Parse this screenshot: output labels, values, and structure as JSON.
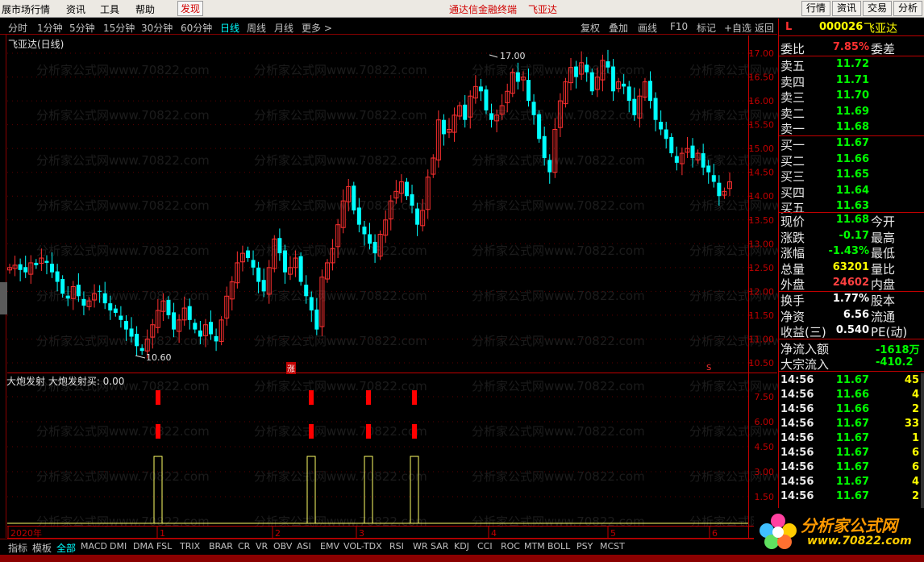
{
  "menubar": {
    "items": [
      "展市场行情",
      "资讯",
      "工具",
      "帮助",
      "发现"
    ],
    "center_text": "通达信金融终端",
    "center_stock": "飞亚达",
    "right_buttons": [
      "行情",
      "资讯",
      "交易",
      "分析"
    ]
  },
  "periods": {
    "items": [
      "分时",
      "1分钟",
      "5分钟",
      "15分钟",
      "30分钟",
      "60分钟",
      "日线",
      "周线",
      "月线",
      "更多 >"
    ],
    "active": "日线",
    "tools": [
      "复权",
      "叠加",
      "画线",
      "F10",
      "标记",
      "+自选",
      "返回"
    ]
  },
  "chart": {
    "title": "飞亚达(日线)",
    "high_label": "17.00",
    "low_label": "10.60",
    "marker_up": "涨",
    "marker_s": "S",
    "price_axis": [
      "17.00",
      "16.50",
      "16.00",
      "15.50",
      "15.00",
      "14.50",
      "14.00",
      "13.50",
      "13.00",
      "12.50",
      "12.00",
      "11.50",
      "11.00",
      "10.50"
    ],
    "indicator_title": "大炮发射  大炮发射买: 0.00",
    "indicator_axis": [
      "7.50",
      "6.00",
      "4.50",
      "3.00",
      "1.50"
    ],
    "date_axis": [
      "2020年",
      "1",
      "2",
      "3",
      "4",
      "5",
      "6"
    ]
  },
  "chart_data": {
    "type": "table",
    "title": "飞亚达(日线)",
    "series": [
      {
        "name": "大炮发射买",
        "values": [
          0.0
        ]
      }
    ],
    "price_range": [
      10.5,
      17.0
    ],
    "high": 17.0,
    "low": 10.6
  },
  "quote": {
    "code": "000026",
    "name": "飞亚达",
    "wb_label": "委比",
    "wb_value": "7.85%",
    "wc_label": "委差",
    "sell": [
      {
        "label": "卖五",
        "price": "11.72"
      },
      {
        "label": "卖四",
        "price": "11.71"
      },
      {
        "label": "卖三",
        "price": "11.70"
      },
      {
        "label": "卖二",
        "price": "11.69"
      },
      {
        "label": "卖一",
        "price": "11.68"
      }
    ],
    "buy": [
      {
        "label": "买一",
        "price": "11.67"
      },
      {
        "label": "买二",
        "price": "11.66"
      },
      {
        "label": "买三",
        "price": "11.65"
      },
      {
        "label": "买四",
        "price": "11.64"
      },
      {
        "label": "买五",
        "price": "11.63"
      }
    ],
    "stats": [
      {
        "label": "现价",
        "value": "11.68",
        "label2": "今开",
        "color": "#00ff00"
      },
      {
        "label": "涨跌",
        "value": "-0.17",
        "label2": "最高",
        "color": "#00ff00"
      },
      {
        "label": "涨幅",
        "value": "-1.43%",
        "label2": "最低",
        "color": "#00ff00"
      },
      {
        "label": "总量",
        "value": "63201",
        "label2": "量比",
        "color": "#ffff00"
      },
      {
        "label": "外盘",
        "value": "24602",
        "label2": "内盘",
        "color": "#ff4040"
      }
    ],
    "stats2": [
      {
        "label": "换手",
        "value": "1.77%",
        "label2": "股本",
        "color": "#ffffff"
      },
      {
        "label": "净资",
        "value": "6.56",
        "label2": "流通",
        "color": "#ffffff"
      },
      {
        "label": "收益(三)",
        "value": "0.540",
        "label2": "PE(动)",
        "color": "#ffffff"
      }
    ],
    "flow": [
      {
        "label": "净流入额",
        "value": "-1618万",
        "color": "#00ff00"
      },
      {
        "label": "大宗流入",
        "value": "-410.2",
        "color": "#00ff00"
      }
    ],
    "ticks": [
      {
        "time": "14:56",
        "price": "11.67",
        "vol": "45"
      },
      {
        "time": "14:56",
        "price": "11.66",
        "vol": "4"
      },
      {
        "time": "14:56",
        "price": "11.66",
        "vol": "2"
      },
      {
        "time": "14:56",
        "price": "11.67",
        "vol": "33"
      },
      {
        "time": "14:56",
        "price": "11.67",
        "vol": "1"
      },
      {
        "time": "14:56",
        "price": "11.67",
        "vol": "6"
      },
      {
        "time": "14:56",
        "price": "11.67",
        "vol": "6"
      },
      {
        "time": "14:56",
        "price": "11.67",
        "vol": "4"
      },
      {
        "time": "14:56",
        "price": "11.67",
        "vol": "2"
      }
    ],
    "l_tag": "L"
  },
  "bottombar": {
    "items": [
      "指标",
      "模板",
      "全部",
      "MACD",
      "DMI",
      "DMA",
      "FSL",
      "TRIX",
      "BRAR",
      "CR",
      "VR",
      "OBV",
      "ASI",
      "EMV",
      "VOL-TDX",
      "RSI",
      "WR",
      "SAR",
      "KDJ",
      "CCI",
      "ROC",
      "MTM",
      "BOLL",
      "PSY",
      "MCST"
    ]
  },
  "logo": {
    "title": "分析家公式网",
    "url": "www.70822.com"
  },
  "watermark": "分析家公式网www.70822.com",
  "colors": {
    "up": "#ff3030",
    "down": "#00ffff",
    "accent": "#ffff00",
    "axis": "#c00000"
  }
}
